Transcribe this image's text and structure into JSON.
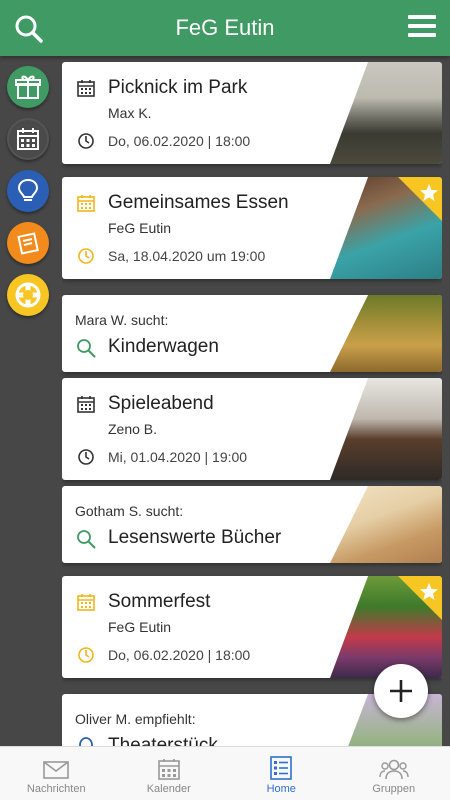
{
  "app": {
    "title": "FeG Eutin"
  },
  "cards": [
    {
      "title": "Picknick im Park",
      "author": "Max K.",
      "date": "Do, 06.02.2020 | 18:00"
    },
    {
      "title": "Gemeinsames Essen",
      "author": "FeG Eutin",
      "date": "Sa, 18.04.2020 um 19:00"
    },
    {
      "who": "Mara W. sucht:",
      "item": "Kinderwagen"
    },
    {
      "title": "Spieleabend",
      "author": "Zeno B.",
      "date": "Mi, 01.04.2020 | 19:00"
    },
    {
      "who": "Gotham S. sucht:",
      "item": "Lesenswerte Bücher"
    },
    {
      "title": "Sommerfest",
      "author": "FeG Eutin",
      "date": "Do, 06.02.2020 | 18:00"
    },
    {
      "who": "Oliver M. empfiehlt:",
      "item": "Theaterstück"
    }
  ],
  "tabs": [
    {
      "label": "Nachrichten"
    },
    {
      "label": "Kalender"
    },
    {
      "label": "Home"
    },
    {
      "label": "Gruppen"
    }
  ],
  "colors": {
    "brand_green": "#3f9a64",
    "highlight_yellow": "#f7c623",
    "active_blue": "#2f6fd0"
  }
}
